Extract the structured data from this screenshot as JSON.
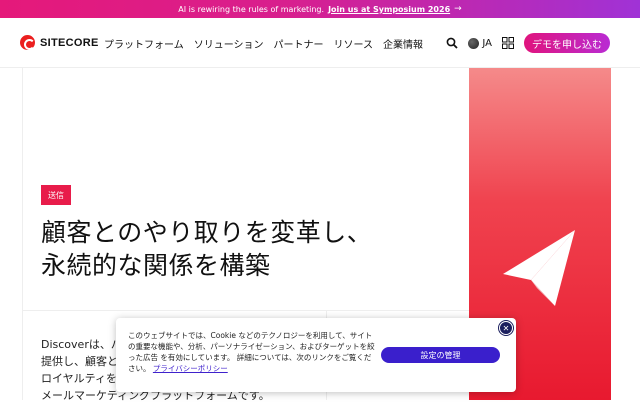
{
  "banner": {
    "text": "AI is rewiring the rules of marketing.",
    "link": "Join us at Symposium 2026",
    "arrow_icon": "arrow-right-icon"
  },
  "header": {
    "logo_text": "SITECORE",
    "nav": [
      "プラットフォーム",
      "ソリューション",
      "パートナー",
      "リソース",
      "企業情報"
    ],
    "language": "JA",
    "demo_button": "デモを申し込む"
  },
  "hero": {
    "tag": "送信",
    "title_line1": "顧客とのやり取りを変革し、",
    "title_line2": "永続的な関係を構築",
    "description": "Discoverは、パ\n提供し、顧客と\nロイヤルティを\nメールマーケティングプラットフォームです。"
  },
  "colors": {
    "accent_pink": "#e5197a",
    "accent_purple": "#a032d6",
    "brand_red": "#eb1f1f",
    "tag_red": "#e81c4a",
    "cookie_button": "#3a1fcc"
  },
  "cookie": {
    "text": "このウェブサイトでは、Cookie などのテクノロジーを利用して、サイトの重要な機能や、分析、パーソナライゼーション、およびターゲットを絞った広告 を有効にしています。 詳細については、次のリンクをご覧ください。",
    "link": "プライバシーポリシー",
    "settings_button": "設定の管理",
    "close_icon": "close-icon"
  }
}
